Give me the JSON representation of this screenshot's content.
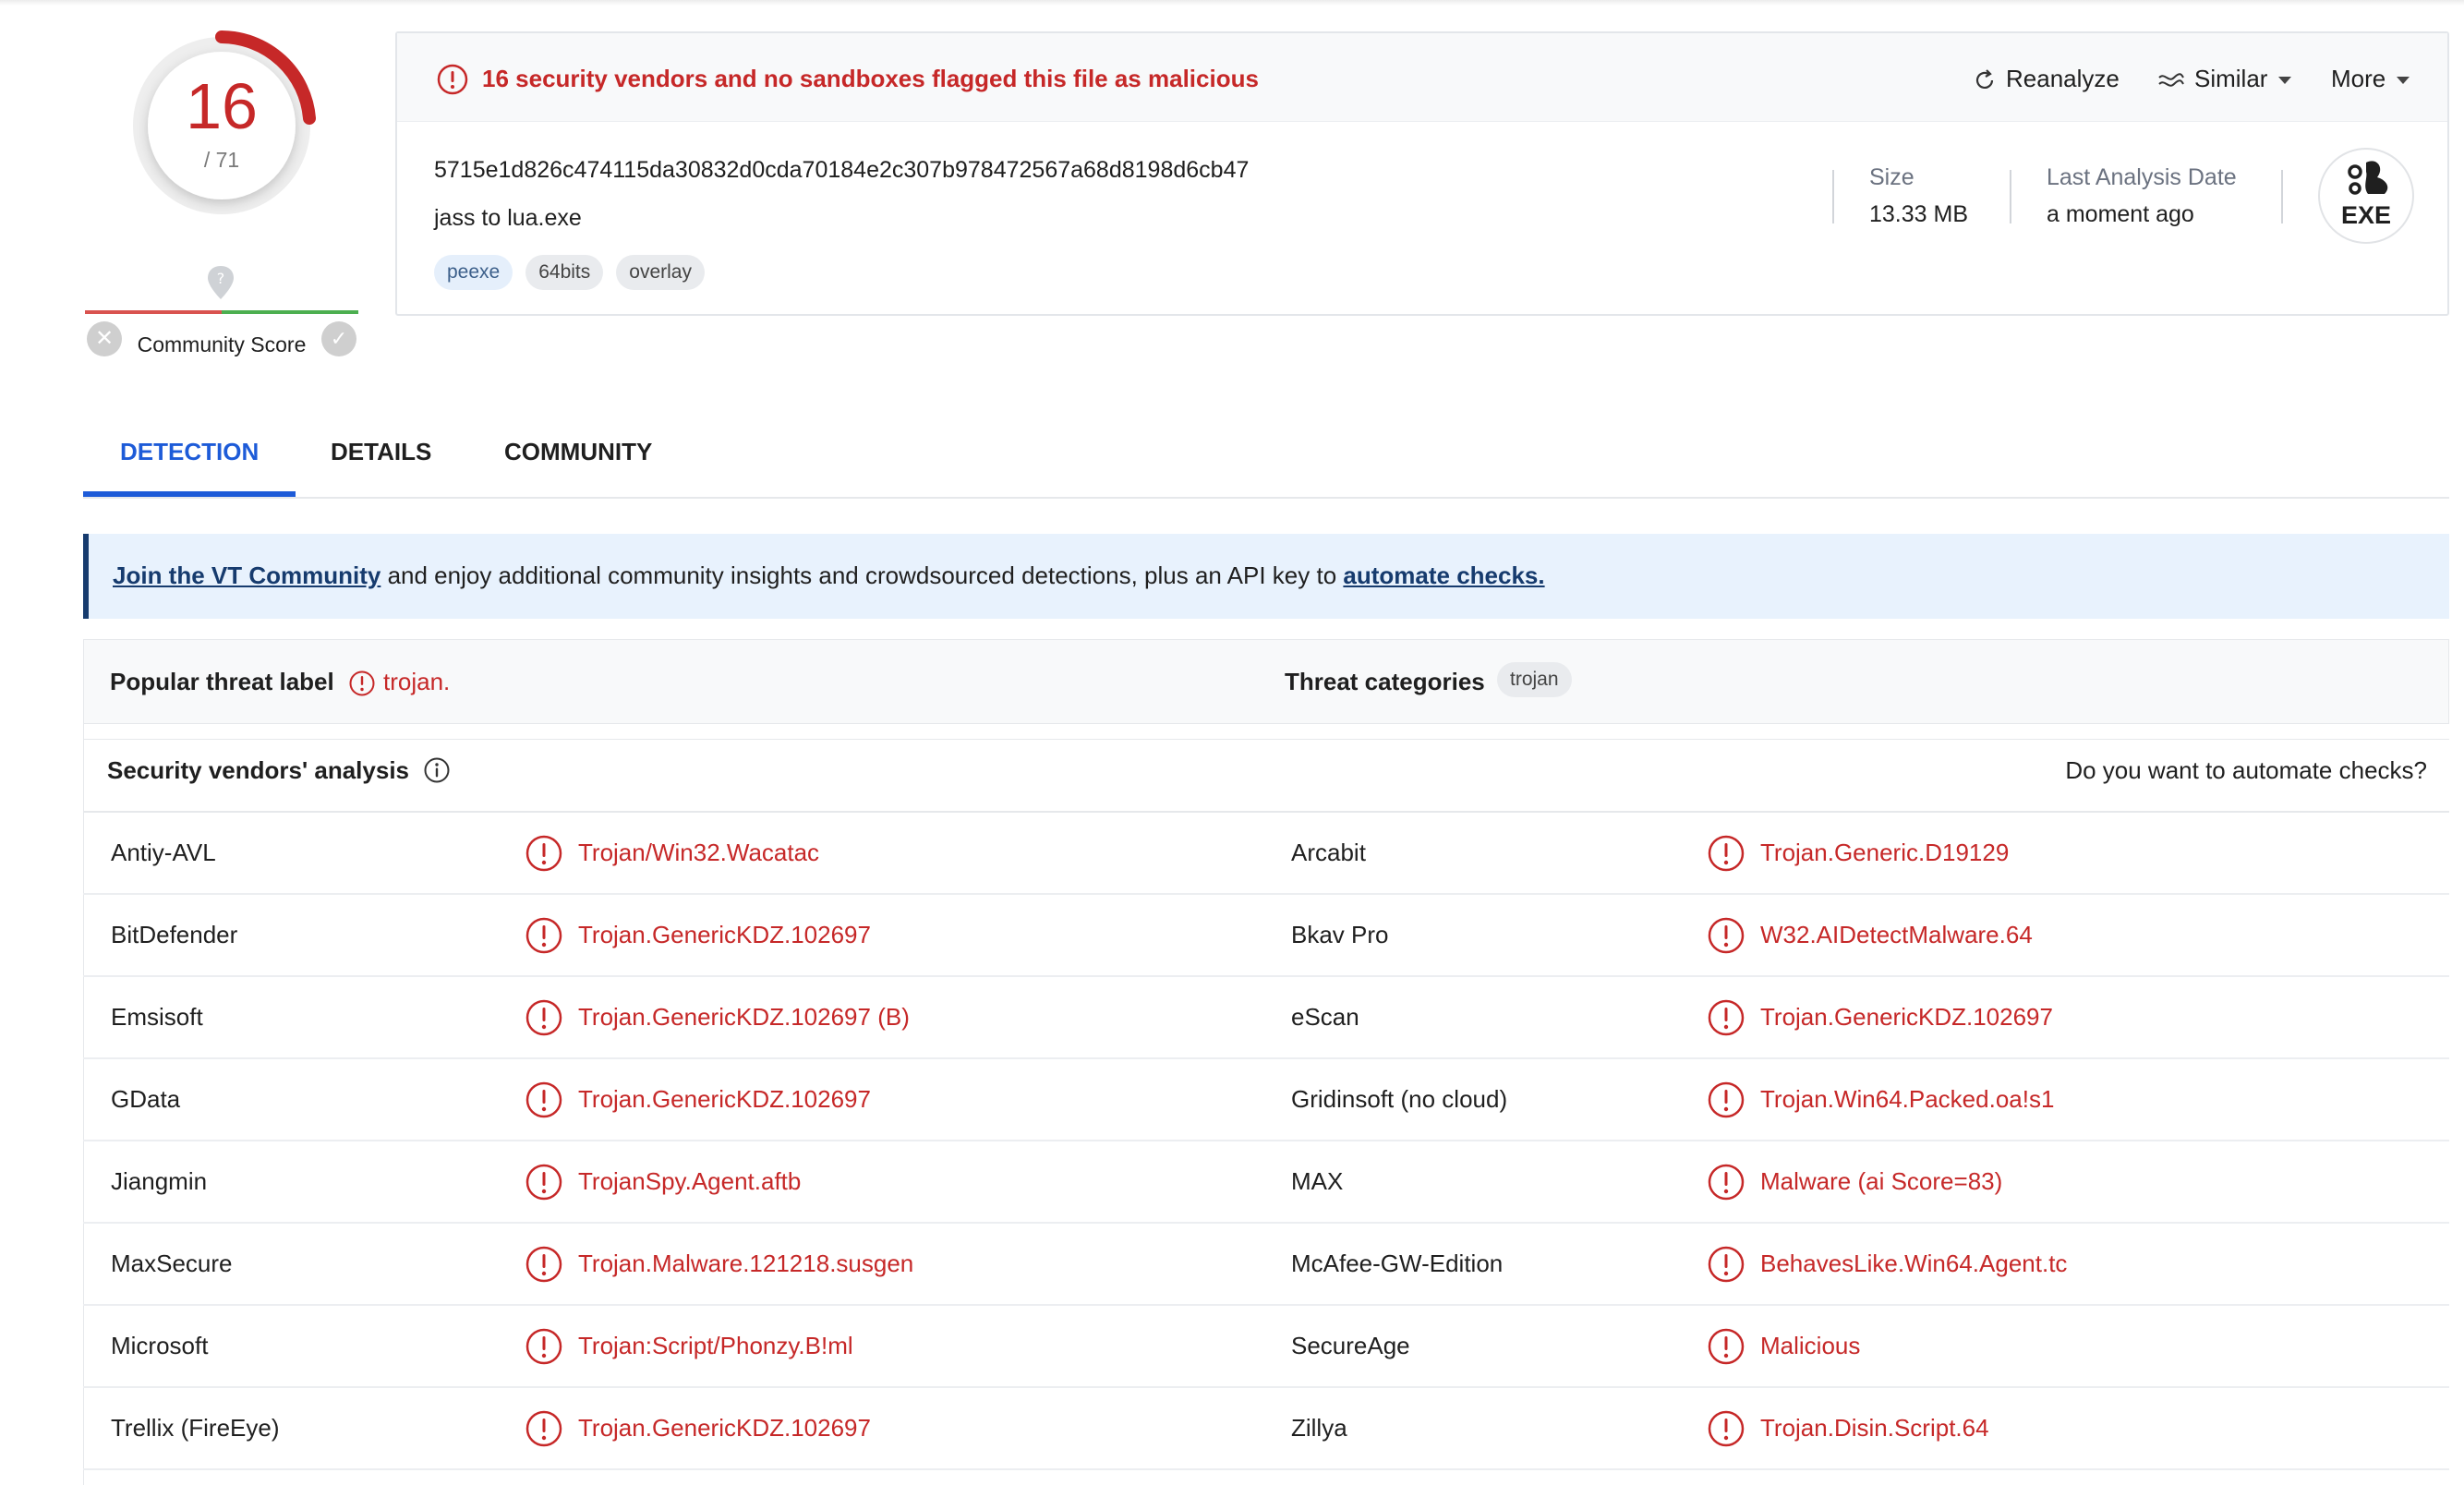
{
  "score": {
    "detections": "16",
    "total": "/ 71"
  },
  "community": {
    "label": "Community Score"
  },
  "alert": {
    "text": "16 security vendors and no sandboxes flagged this file as malicious"
  },
  "actions": {
    "reanalyze": "Reanalyze",
    "similar": "Similar",
    "more": "More"
  },
  "file": {
    "hash": "5715e1d826c474115da30832d0cda70184e2c307b978472567a68d8198d6cb47",
    "name": "jass to lua.exe",
    "tags": [
      "peexe",
      "64bits",
      "overlay"
    ],
    "size_label": "Size",
    "size_value": "13.33 MB",
    "date_label": "Last Analysis Date",
    "date_value": "a moment ago",
    "type_badge": "EXE"
  },
  "tabs": [
    "DETECTION",
    "DETAILS",
    "COMMUNITY"
  ],
  "banner": {
    "link1": "Join the VT Community",
    "middle": " and enjoy additional community insights and crowdsourced detections, plus an API key to ",
    "link2": "automate checks."
  },
  "threat": {
    "label": "Popular threat label",
    "value": "trojan.",
    "categories_label": "Threat categories",
    "category": "trojan"
  },
  "vendors_header": {
    "title": "Security vendors' analysis",
    "right": "Do you want to automate checks?"
  },
  "vendors": [
    {
      "name": "Antiy-AVL",
      "result": "Trojan/Win32.Wacatac",
      "name2": "Arcabit",
      "result2": "Trojan.Generic.D19129"
    },
    {
      "name": "BitDefender",
      "result": "Trojan.GenericKDZ.102697",
      "name2": "Bkav Pro",
      "result2": "W32.AIDetectMalware.64"
    },
    {
      "name": "Emsisoft",
      "result": "Trojan.GenericKDZ.102697 (B)",
      "name2": "eScan",
      "result2": "Trojan.GenericKDZ.102697"
    },
    {
      "name": "GData",
      "result": "Trojan.GenericKDZ.102697",
      "name2": "Gridinsoft (no cloud)",
      "result2": "Trojan.Win64.Packed.oa!s1"
    },
    {
      "name": "Jiangmin",
      "result": "TrojanSpy.Agent.aftb",
      "name2": "MAX",
      "result2": "Malware (ai Score=83)"
    },
    {
      "name": "MaxSecure",
      "result": "Trojan.Malware.121218.susgen",
      "name2": "McAfee-GW-Edition",
      "result2": "BehavesLike.Win64.Agent.tc"
    },
    {
      "name": "Microsoft",
      "result": "Trojan:Script/Phonzy.B!ml",
      "name2": "SecureAge",
      "result2": "Malicious"
    },
    {
      "name": "Trellix (FireEye)",
      "result": "Trojan.GenericKDZ.102697",
      "name2": "Zillya",
      "result2": "Trojan.Disin.Script.64"
    }
  ],
  "colors": {
    "malicious": "#c62828",
    "accent": "#1d5bd8",
    "banner_bg": "#e8f2fd",
    "banner_border": "#163b6e"
  }
}
